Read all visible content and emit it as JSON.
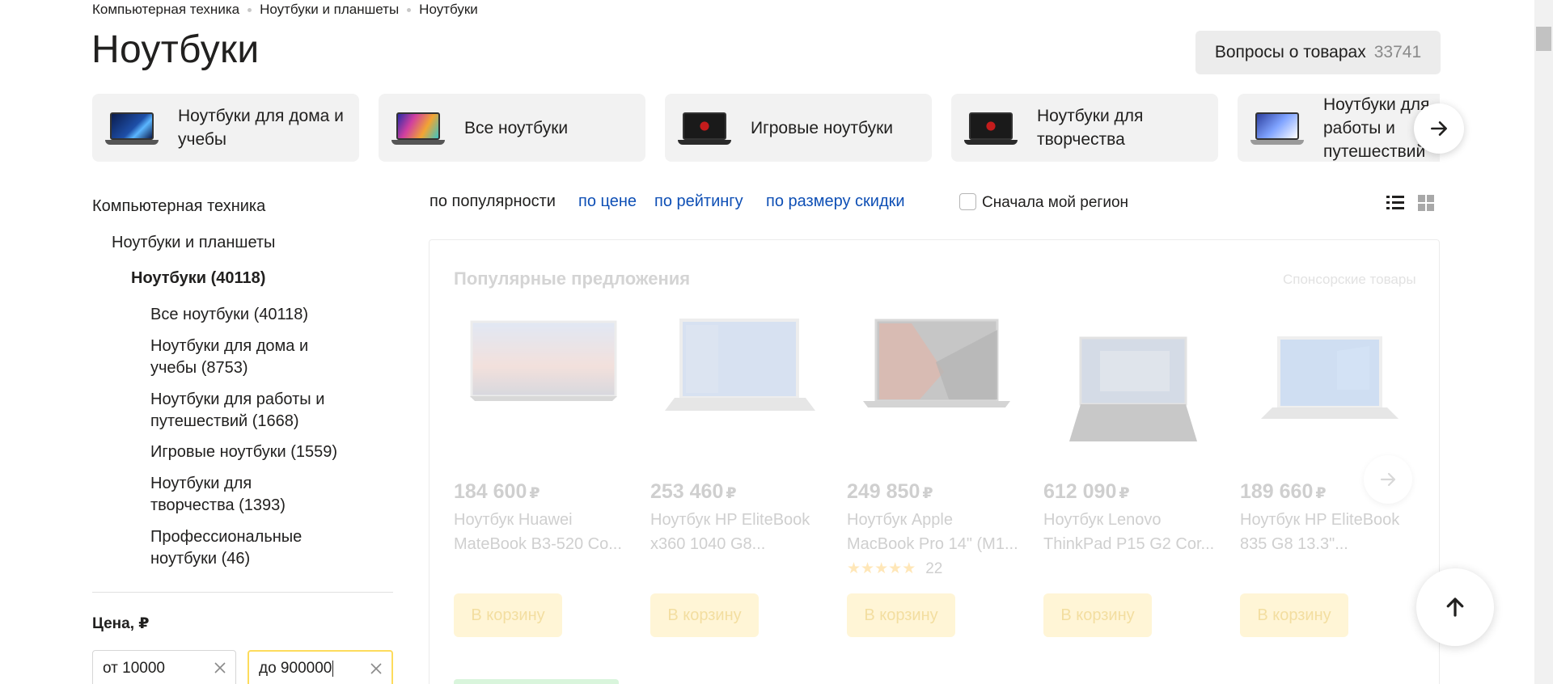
{
  "breadcrumb": [
    "Компьютерная техника",
    "Ноутбуки и планшеты",
    "Ноутбуки"
  ],
  "page_title": "Ноутбуки",
  "questions": {
    "label": "Вопросы о товарах",
    "count": "33741"
  },
  "categories": [
    {
      "label": "Ноутбуки для дома и учебы",
      "icon": "laptop-blue-wallpaper-icon"
    },
    {
      "label": "Все ноутбуки",
      "icon": "laptop-colorful-icon"
    },
    {
      "label": "Игровые ноутбуки",
      "icon": "gaming-laptop-icon"
    },
    {
      "label": "Ноутбуки для творчества",
      "icon": "gaming-laptop-icon"
    },
    {
      "label": "Ноутбуки для работы и путешествий",
      "icon": "laptop-light-icon"
    }
  ],
  "sidebar": {
    "root": "Компьютерная техника",
    "level1": "Ноутбуки и планшеты",
    "current": "Ноутбуки (40118)",
    "items": [
      {
        "line1": "Все ноутбуки (40118)",
        "line2": ""
      },
      {
        "line1": "Ноутбуки для дома и",
        "line2": "учебы (8753)"
      },
      {
        "line1": "Ноутбуки для работы и",
        "line2": "путешествий (1668)"
      },
      {
        "line1": "Игровые ноутбуки (1559)",
        "line2": ""
      },
      {
        "line1": "Ноутбуки для",
        "line2": "творчества (1393)"
      },
      {
        "line1": "Профессиональные",
        "line2": "ноутбуки (46)"
      }
    ]
  },
  "price_filter": {
    "title": "Цена, ₽",
    "from": "от 10000",
    "to": "до 900000"
  },
  "sort": {
    "popular": "по популярности",
    "price": "по цене",
    "rating": "по рейтингу",
    "discount": "по размеру скидки",
    "region_checkbox": "Сначала мой регион"
  },
  "popular": {
    "title": "Популярные предложения",
    "sponsor": "Спонсорские товары",
    "cart_label": "В корзину",
    "currency": "₽",
    "products": [
      {
        "price": "184 600",
        "name1": "Ноутбук Huawei",
        "name2": "MateBook B3-520 Co...",
        "rating": 0,
        "reviews": ""
      },
      {
        "price": "253 460",
        "name1": "Ноутбук HP EliteBook",
        "name2": "x360 1040 G8...",
        "rating": 0,
        "reviews": ""
      },
      {
        "price": "249 850",
        "name1": "Ноутбук Apple",
        "name2": "MacBook Pro 14\" (M1...",
        "rating": 4.5,
        "reviews": "22"
      },
      {
        "price": "612 090",
        "name1": "Ноутбук Lenovo",
        "name2": "ThinkPad P15 G2 Cor...",
        "rating": 0,
        "reviews": ""
      },
      {
        "price": "189 660",
        "name1": "Ноутбук HP EliteBook",
        "name2": "835 G8 13.3\"...",
        "rating": 0,
        "reviews": ""
      }
    ]
  }
}
